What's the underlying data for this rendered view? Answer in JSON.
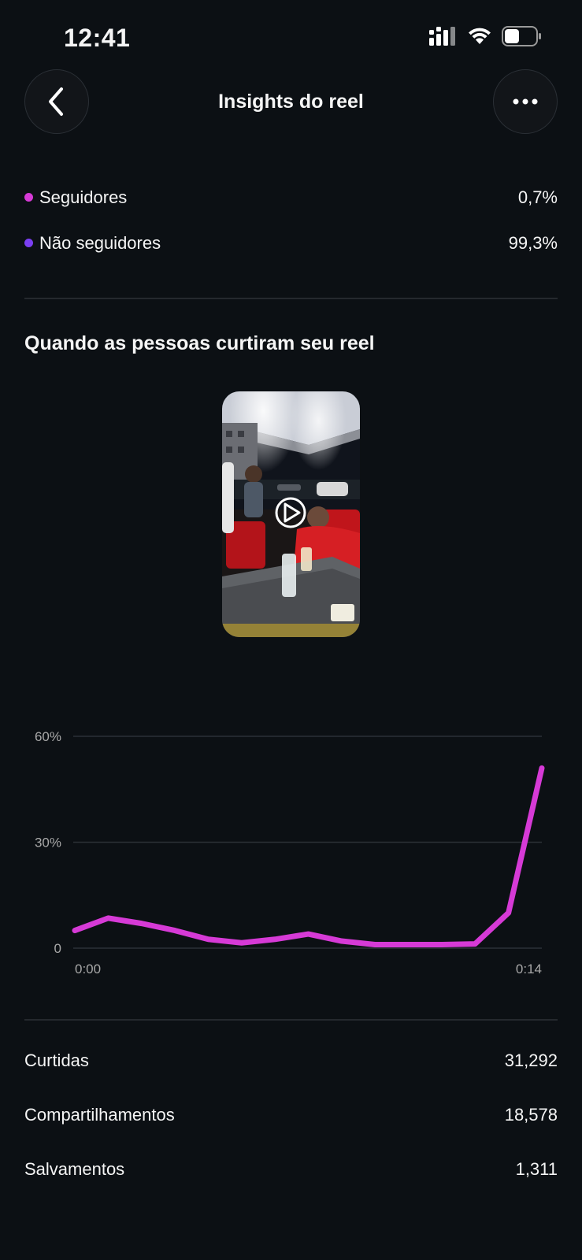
{
  "status_bar": {
    "time": "12:41"
  },
  "header": {
    "title": "Insights do reel"
  },
  "audience": [
    {
      "label": "Seguidores",
      "value": "0,7%",
      "color": "#d63ad6"
    },
    {
      "label": "Não seguidores",
      "value": "99,3%",
      "color": "#7b3ff2"
    }
  ],
  "likes_section": {
    "title": "Quando as pessoas curtiram seu reel"
  },
  "chart_data": {
    "type": "line",
    "y_ticks": [
      "60%",
      "30%",
      "0"
    ],
    "x_ticks": [
      "0:00",
      "0:14"
    ],
    "ylim": [
      0,
      60
    ],
    "x": [
      0,
      1,
      2,
      3,
      4,
      5,
      6,
      7,
      8,
      9,
      10,
      11,
      12,
      13,
      14
    ],
    "series": [
      {
        "values": [
          5,
          8.5,
          7,
          5,
          2.5,
          1.5,
          2.5,
          4,
          2,
          1,
          1,
          1,
          1.2,
          10,
          51
        ],
        "color": "#d63ad6"
      }
    ],
    "grid": true
  },
  "stats": [
    {
      "label": "Curtidas",
      "value": "31,292"
    },
    {
      "label": "Compartilhamentos",
      "value": "18,578"
    },
    {
      "label": "Salvamentos",
      "value": "1,311"
    }
  ]
}
